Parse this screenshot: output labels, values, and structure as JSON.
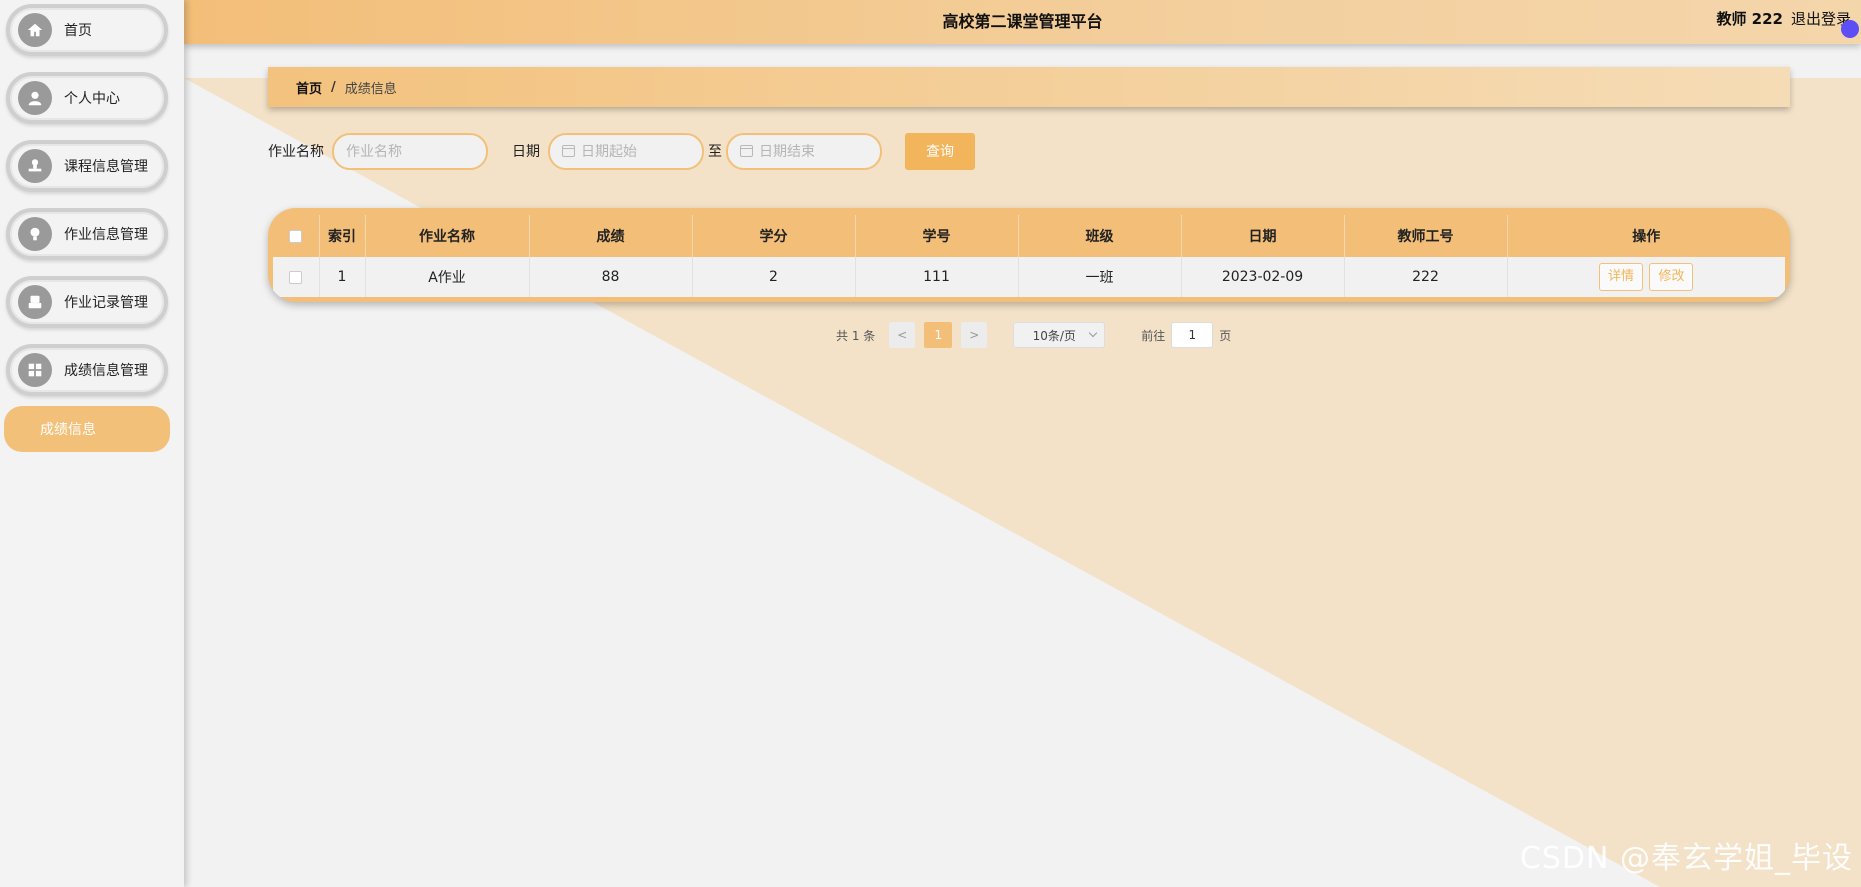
{
  "app": {
    "title": "高校第二课堂管理平台",
    "user": "教师 222",
    "logout": "退出登录"
  },
  "colors": {
    "accent": "#f2b55c",
    "header": "#f3be78",
    "background_triangle": "#f3e2c8"
  },
  "sidebar": {
    "items": [
      {
        "label": "首页",
        "icon": "home-icon"
      },
      {
        "label": "个人中心",
        "icon": "user-icon"
      },
      {
        "label": "课程信息管理",
        "icon": "stamp-icon"
      },
      {
        "label": "作业信息管理",
        "icon": "lightbulb-icon"
      },
      {
        "label": "作业记录管理",
        "icon": "printer-icon"
      },
      {
        "label": "成绩信息管理",
        "icon": "grid-icon"
      }
    ],
    "active_sub": "成绩信息"
  },
  "breadcrumb": {
    "home": "首页",
    "separator": "/",
    "current": "成绩信息"
  },
  "search": {
    "name_label": "作业名称",
    "name_placeholder": "作业名称",
    "date_label": "日期",
    "date_start_placeholder": "日期起始",
    "date_to": "至",
    "date_end_placeholder": "日期结束",
    "query_button": "查询"
  },
  "table": {
    "headers": [
      "索引",
      "作业名称",
      "成绩",
      "学分",
      "学号",
      "班级",
      "日期",
      "教师工号",
      "操作"
    ],
    "rows": [
      {
        "index": "1",
        "name": "A作业",
        "score": "88",
        "credit": "2",
        "student_no": "111",
        "class": "一班",
        "date": "2023-02-09",
        "teacher_no": "222"
      }
    ],
    "actions": {
      "detail": "详情",
      "edit": "修改"
    }
  },
  "pager": {
    "total": "共 1 条",
    "prev": "<",
    "page": "1",
    "next": ">",
    "size": "10条/页",
    "goto_label": "前往",
    "goto_value": "1",
    "page_suffix": "页"
  },
  "watermark": "CSDN @奉玄学姐_毕设"
}
